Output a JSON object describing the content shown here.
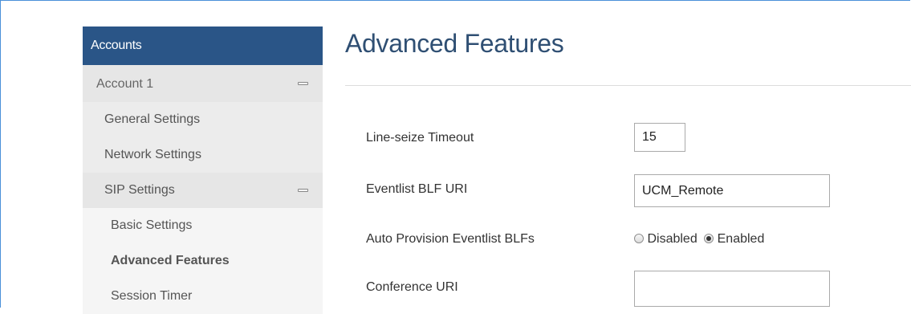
{
  "sidebar": {
    "header": "Accounts",
    "items": [
      {
        "label": "Account 1"
      },
      {
        "label": "General Settings"
      },
      {
        "label": "Network Settings"
      },
      {
        "label": "SIP Settings"
      },
      {
        "label": "Basic Settings"
      },
      {
        "label": "Advanced Features"
      },
      {
        "label": "Session Timer"
      }
    ]
  },
  "main": {
    "title": "Advanced Features",
    "fields": {
      "line_seize_timeout": {
        "label": "Line-seize Timeout",
        "value": "15"
      },
      "eventlist_blf_uri": {
        "label": "Eventlist BLF URI",
        "value": "UCM_Remote"
      },
      "auto_provision": {
        "label": "Auto Provision Eventlist BLFs",
        "options": [
          "Disabled",
          "Enabled"
        ],
        "selected": "Enabled"
      },
      "conference_uri": {
        "label": "Conference URI",
        "value": ""
      }
    }
  },
  "colors": {
    "sidebar_header_bg": "#2a5587",
    "title_color": "#2f4f73",
    "frame_border": "#4a90d9"
  }
}
